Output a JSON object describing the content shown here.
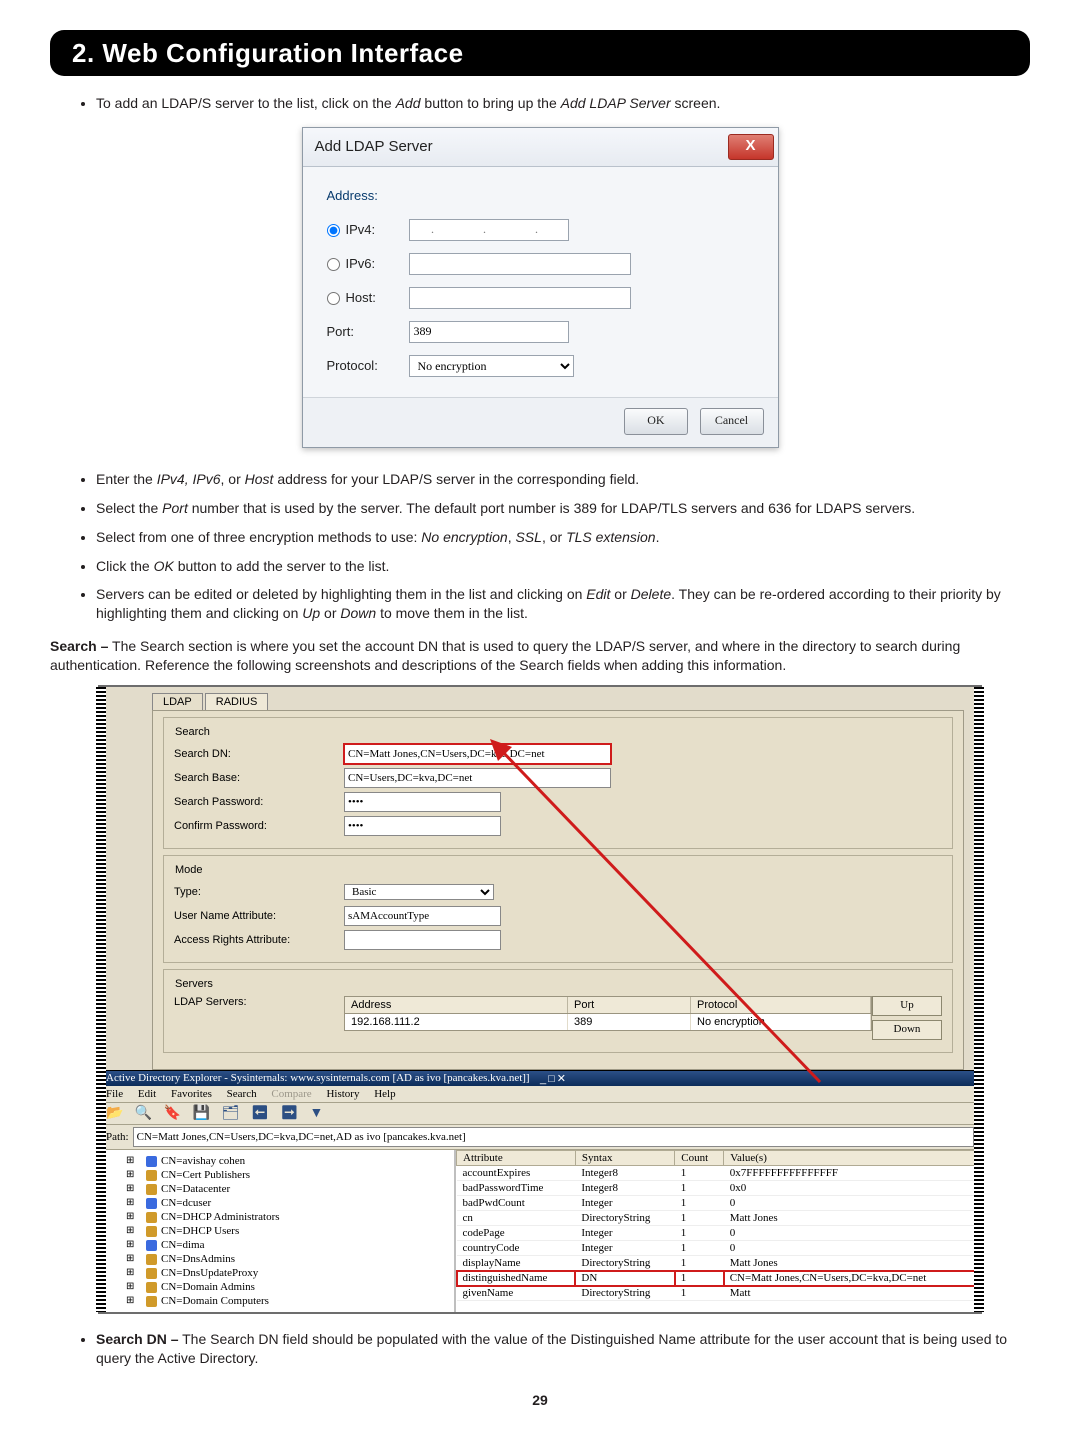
{
  "header": "2. Web Configuration Interface",
  "intro": "To add an LDAP/S server to the list, click on the Add button to bring up the Add LDAP Server screen.",
  "dlg": {
    "title": "Add LDAP Server",
    "close": "X",
    "addr_lbl": "Address:",
    "ipv4": "IPv4:",
    "ipv6": "IPv6:",
    "host": "Host:",
    "ip_ph": ".   .   .",
    "port_lbl": "Port:",
    "port_val": "389",
    "proto_lbl": "Protocol:",
    "proto_val": "No encryption",
    "ok": "OK",
    "cancel": "Cancel"
  },
  "bul": [
    "Enter the IPv4, IPv6, or Host address for your LDAP/S server in the corresponding field.",
    "Select the Port number that is used by the server. The default port number is 389 for LDAP/TLS servers and 636 for LDAPS servers.",
    "Select from one of three encryption methods to use: No encryption, SSL, or TLS extension.",
    "Click the OK button to add the server to the list.",
    "Servers can be edited or deleted by highlighting them in the list and clicking on Edit or Delete. They can be re-ordered according to their priority by highlighting them and clicking on Up or Down to move them in the list."
  ],
  "search_para_lead": "Search –",
  "search_para": " The Search section is where you set the account DN that is used to query the LDAP/S server, and where in the directory to search during authentication. Reference the following screenshots and descriptions of the Search fields when adding this information.",
  "tabs": {
    "ldap": "LDAP",
    "radius": "RADIUS"
  },
  "grp": {
    "search": "Search",
    "mode": "Mode",
    "servers": "Servers",
    "dn_l": "Search DN:",
    "dn_v": "CN=Matt Jones,CN=Users,DC=kva,DC=net",
    "base_l": "Search Base:",
    "base_v": "CN=Users,DC=kva,DC=net",
    "pw_l": "Search Password:",
    "cpw_l": "Confirm Password:",
    "mask": "••••",
    "type_l": "Type:",
    "type_v": "Basic",
    "una_l": "User Name Attribute:",
    "una_v": "sAMAccountType",
    "ara_l": "Access Rights Attribute:",
    "srv_l": "LDAP Servers:",
    "th_addr": "Address",
    "th_port": "Port",
    "th_proto": "Protocol",
    "tr_addr": "192.168.111.2",
    "tr_port": "389",
    "tr_proto": "No encryption",
    "up": "Up",
    "down": "Down"
  },
  "adx": {
    "title": "Active Directory Explorer - Sysinternals: www.sysinternals.com [AD as ivo [pancakes.kva.net]]",
    "menu": [
      "File",
      "Edit",
      "Favorites",
      "Search",
      "Compare",
      "History",
      "Help"
    ],
    "path_l": "Path:",
    "path_v": "CN=Matt Jones,CN=Users,DC=kva,DC=net,AD as ivo [pancakes.kva.net]",
    "tree": [
      {
        "t": "usr",
        "l": "CN=avishay cohen"
      },
      {
        "t": "grp",
        "l": "CN=Cert Publishers"
      },
      {
        "t": "grp",
        "l": "CN=Datacenter"
      },
      {
        "t": "usr",
        "l": "CN=dcuser"
      },
      {
        "t": "grp",
        "l": "CN=DHCP Administrators"
      },
      {
        "t": "grp",
        "l": "CN=DHCP Users"
      },
      {
        "t": "usr",
        "l": "CN=dima"
      },
      {
        "t": "grp",
        "l": "CN=DnsAdmins"
      },
      {
        "t": "grp",
        "l": "CN=DnsUpdateProxy"
      },
      {
        "t": "grp",
        "l": "CN=Domain Admins"
      },
      {
        "t": "grp",
        "l": "CN=Domain Computers"
      }
    ],
    "th": [
      "Attribute",
      "Syntax",
      "Count",
      "Value(s)"
    ],
    "rows": [
      [
        "accountExpires",
        "Integer8",
        "1",
        "0x7FFFFFFFFFFFFFFF"
      ],
      [
        "badPasswordTime",
        "Integer8",
        "1",
        "0x0"
      ],
      [
        "badPwdCount",
        "Integer",
        "1",
        "0"
      ],
      [
        "cn",
        "DirectoryString",
        "1",
        "Matt Jones"
      ],
      [
        "codePage",
        "Integer",
        "1",
        "0"
      ],
      [
        "countryCode",
        "Integer",
        "1",
        "0"
      ],
      [
        "displayName",
        "DirectoryString",
        "1",
        "Matt Jones"
      ],
      [
        "distinguishedName",
        "DN",
        "1",
        "CN=Matt Jones,CN=Users,DC=kva,DC=net"
      ],
      [
        "givenName",
        "DirectoryString",
        "1",
        "Matt"
      ]
    ],
    "hl": 7
  },
  "foot": {
    "lead": "Search DN –",
    "txt": " The Search DN field should be populated with the value of the Distinguished Name attribute for the user account that is being used to query the Active Directory."
  },
  "pagenum": "29"
}
